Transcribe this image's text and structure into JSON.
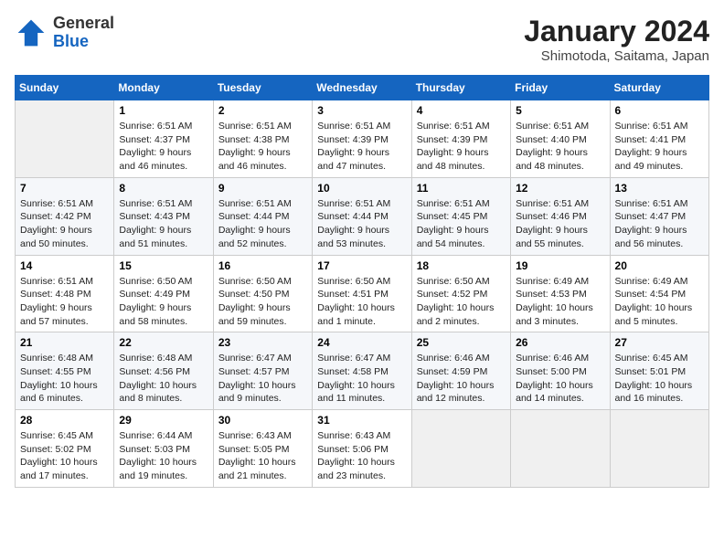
{
  "header": {
    "logo_general": "General",
    "logo_blue": "Blue",
    "month_title": "January 2024",
    "location": "Shimotoda, Saitama, Japan"
  },
  "days_of_week": [
    "Sunday",
    "Monday",
    "Tuesday",
    "Wednesday",
    "Thursday",
    "Friday",
    "Saturday"
  ],
  "weeks": [
    [
      {
        "day": "",
        "empty": true
      },
      {
        "day": "1",
        "sunrise": "6:51 AM",
        "sunset": "4:37 PM",
        "daylight": "9 hours and 46 minutes."
      },
      {
        "day": "2",
        "sunrise": "6:51 AM",
        "sunset": "4:38 PM",
        "daylight": "9 hours and 46 minutes."
      },
      {
        "day": "3",
        "sunrise": "6:51 AM",
        "sunset": "4:39 PM",
        "daylight": "9 hours and 47 minutes."
      },
      {
        "day": "4",
        "sunrise": "6:51 AM",
        "sunset": "4:39 PM",
        "daylight": "9 hours and 48 minutes."
      },
      {
        "day": "5",
        "sunrise": "6:51 AM",
        "sunset": "4:40 PM",
        "daylight": "9 hours and 48 minutes."
      },
      {
        "day": "6",
        "sunrise": "6:51 AM",
        "sunset": "4:41 PM",
        "daylight": "9 hours and 49 minutes."
      }
    ],
    [
      {
        "day": "7",
        "sunrise": "6:51 AM",
        "sunset": "4:42 PM",
        "daylight": "9 hours and 50 minutes."
      },
      {
        "day": "8",
        "sunrise": "6:51 AM",
        "sunset": "4:43 PM",
        "daylight": "9 hours and 51 minutes."
      },
      {
        "day": "9",
        "sunrise": "6:51 AM",
        "sunset": "4:44 PM",
        "daylight": "9 hours and 52 minutes."
      },
      {
        "day": "10",
        "sunrise": "6:51 AM",
        "sunset": "4:44 PM",
        "daylight": "9 hours and 53 minutes."
      },
      {
        "day": "11",
        "sunrise": "6:51 AM",
        "sunset": "4:45 PM",
        "daylight": "9 hours and 54 minutes."
      },
      {
        "day": "12",
        "sunrise": "6:51 AM",
        "sunset": "4:46 PM",
        "daylight": "9 hours and 55 minutes."
      },
      {
        "day": "13",
        "sunrise": "6:51 AM",
        "sunset": "4:47 PM",
        "daylight": "9 hours and 56 minutes."
      }
    ],
    [
      {
        "day": "14",
        "sunrise": "6:51 AM",
        "sunset": "4:48 PM",
        "daylight": "9 hours and 57 minutes."
      },
      {
        "day": "15",
        "sunrise": "6:50 AM",
        "sunset": "4:49 PM",
        "daylight": "9 hours and 58 minutes."
      },
      {
        "day": "16",
        "sunrise": "6:50 AM",
        "sunset": "4:50 PM",
        "daylight": "9 hours and 59 minutes."
      },
      {
        "day": "17",
        "sunrise": "6:50 AM",
        "sunset": "4:51 PM",
        "daylight": "10 hours and 1 minute."
      },
      {
        "day": "18",
        "sunrise": "6:50 AM",
        "sunset": "4:52 PM",
        "daylight": "10 hours and 2 minutes."
      },
      {
        "day": "19",
        "sunrise": "6:49 AM",
        "sunset": "4:53 PM",
        "daylight": "10 hours and 3 minutes."
      },
      {
        "day": "20",
        "sunrise": "6:49 AM",
        "sunset": "4:54 PM",
        "daylight": "10 hours and 5 minutes."
      }
    ],
    [
      {
        "day": "21",
        "sunrise": "6:48 AM",
        "sunset": "4:55 PM",
        "daylight": "10 hours and 6 minutes."
      },
      {
        "day": "22",
        "sunrise": "6:48 AM",
        "sunset": "4:56 PM",
        "daylight": "10 hours and 8 minutes."
      },
      {
        "day": "23",
        "sunrise": "6:47 AM",
        "sunset": "4:57 PM",
        "daylight": "10 hours and 9 minutes."
      },
      {
        "day": "24",
        "sunrise": "6:47 AM",
        "sunset": "4:58 PM",
        "daylight": "10 hours and 11 minutes."
      },
      {
        "day": "25",
        "sunrise": "6:46 AM",
        "sunset": "4:59 PM",
        "daylight": "10 hours and 12 minutes."
      },
      {
        "day": "26",
        "sunrise": "6:46 AM",
        "sunset": "5:00 PM",
        "daylight": "10 hours and 14 minutes."
      },
      {
        "day": "27",
        "sunrise": "6:45 AM",
        "sunset": "5:01 PM",
        "daylight": "10 hours and 16 minutes."
      }
    ],
    [
      {
        "day": "28",
        "sunrise": "6:45 AM",
        "sunset": "5:02 PM",
        "daylight": "10 hours and 17 minutes."
      },
      {
        "day": "29",
        "sunrise": "6:44 AM",
        "sunset": "5:03 PM",
        "daylight": "10 hours and 19 minutes."
      },
      {
        "day": "30",
        "sunrise": "6:43 AM",
        "sunset": "5:05 PM",
        "daylight": "10 hours and 21 minutes."
      },
      {
        "day": "31",
        "sunrise": "6:43 AM",
        "sunset": "5:06 PM",
        "daylight": "10 hours and 23 minutes."
      },
      {
        "day": "",
        "empty": true
      },
      {
        "day": "",
        "empty": true
      },
      {
        "day": "",
        "empty": true
      }
    ]
  ]
}
